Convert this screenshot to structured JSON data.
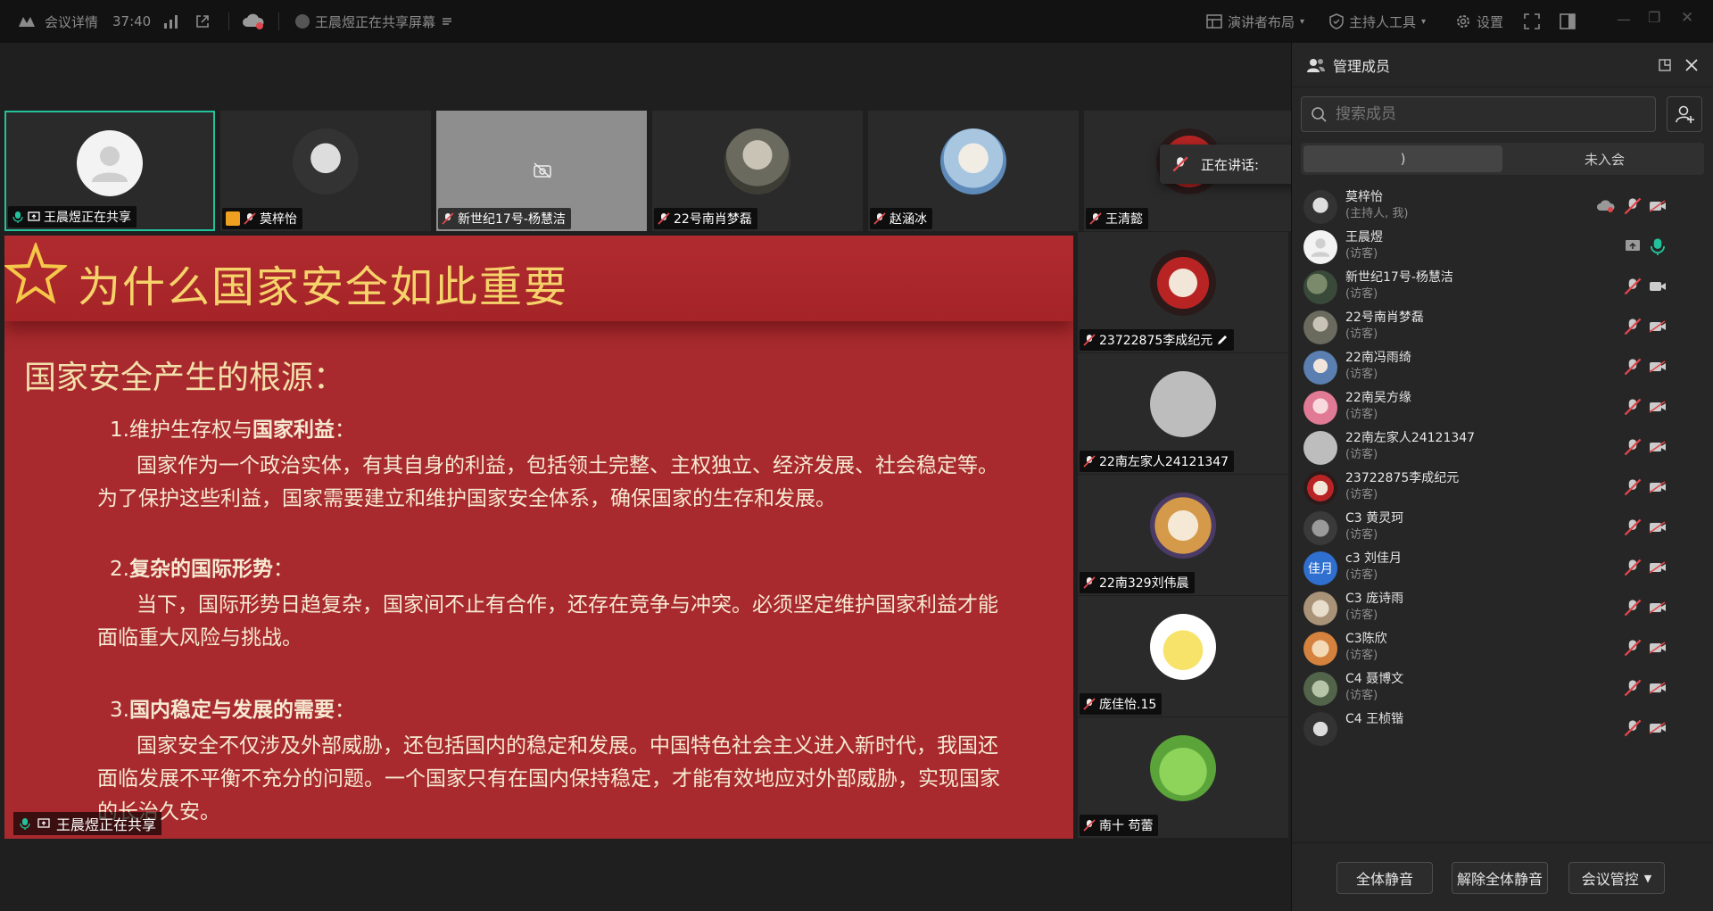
{
  "topbar": {
    "meeting_info": "会议详情",
    "duration": "37:40",
    "sharing_status": "王晨煜正在共享屏幕",
    "presenter_layout": "演讲者布局",
    "host_tools": "主持人工具",
    "settings": "设置"
  },
  "participants_top": [
    {
      "name": "王晨煜正在共享"
    },
    {
      "name": "莫梓怡"
    },
    {
      "name": "新世纪17号-杨慧洁"
    },
    {
      "name": "22号南肖梦磊"
    },
    {
      "name": "赵涵冰"
    },
    {
      "name": "王清懿"
    }
  ],
  "participants_side": [
    {
      "name": "23722875李成纪元"
    },
    {
      "name": "22南左家人24121347"
    },
    {
      "name": "22南329刘伟晨"
    },
    {
      "name": "庞佳怡.15"
    },
    {
      "name": "南十 苟蕾"
    }
  ],
  "speaking_tooltip": "正在讲话:",
  "slide": {
    "title": "为什么国家安全如此重要",
    "subtitle": "国家安全产生的根源：",
    "sec1_num": "1.维护生存权与",
    "sec1_bold": "国家利益",
    "sec1_colon": "：",
    "sec1_text": "国家作为一个政治实体，有其自身的利益，包括领土完整、主权独立、经济发展、社会稳定等。为了保护这些利益，国家需要建立和维护国家安全体系，确保国家的生存和发展。",
    "sec2_num": "2.",
    "sec2_bold": "复杂的国际形势",
    "sec2_colon": "：",
    "sec2_text": "当下，国际形势日趋复杂，国家间不止有合作，还存在竞争与冲突。必须坚定维护国家利益才能面临重大风险与挑战。",
    "sec3_num": "3.",
    "sec3_bold": "国内稳定与发展的需要",
    "sec3_colon": "：",
    "sec3_text": "国家安全不仅涉及外部威胁，还包括国内的稳定和发展。中国特色社会主义进入新时代，我国还面临发展不平衡不充分的问题。一个国家只有在国内保持稳定，才能有效地应对外部威胁，实现国家的长治久安。",
    "sharer_label": "王晨煜正在共享"
  },
  "panel": {
    "title": "管理成员",
    "search_placeholder": "搜索成员",
    "tab_in": ")",
    "tab_out": "未入会",
    "members": [
      {
        "name": "莫梓怡",
        "role": "(主持人, 我)"
      },
      {
        "name": "王晨煜",
        "role": "(访客)"
      },
      {
        "name": "新世纪17号-杨慧洁",
        "role": "(访客)"
      },
      {
        "name": "22号南肖梦磊",
        "role": "(访客)"
      },
      {
        "name": "22南冯雨绮",
        "role": "(访客)"
      },
      {
        "name": "22南吴方缘",
        "role": "(访客)"
      },
      {
        "name": "22南左家人24121347",
        "role": "(访客)"
      },
      {
        "name": "23722875李成纪元",
        "role": "(访客)"
      },
      {
        "name": "C3 黄灵珂",
        "role": "(访客)"
      },
      {
        "name": "c3 刘佳月",
        "role": "(访客)",
        "avatar_text": "佳月"
      },
      {
        "name": "C3 庞诗雨",
        "role": "(访客)"
      },
      {
        "name": "C3陈欣",
        "role": "(访客)"
      },
      {
        "name": "C4 聂博文",
        "role": "(访客)"
      },
      {
        "name": "C4 王桢锴",
        "role": ""
      }
    ],
    "mute_all": "全体静音",
    "unmute_all": "解除全体静音",
    "meeting_control": "会议管控"
  },
  "colors": {
    "accent": "#22c39b",
    "slide_bg": "#a82a2e",
    "title_gold": "#f6d36a",
    "mic_muted": "#e0474c"
  }
}
